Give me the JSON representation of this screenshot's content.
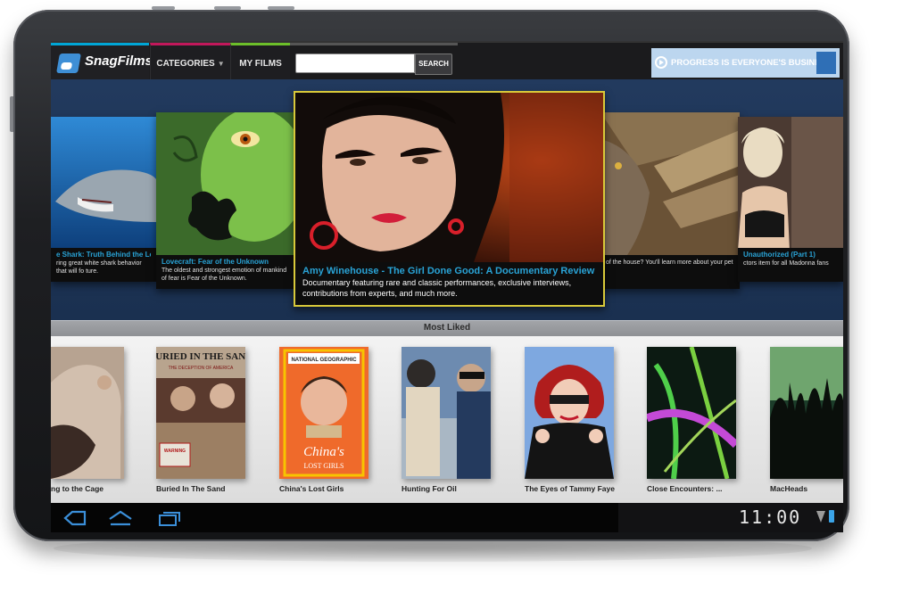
{
  "brand": {
    "name": "SnagFilms",
    "accent": "#00a6d6"
  },
  "nav": {
    "categories_label": "CATEGORIES",
    "my_films_label": "MY FILMS",
    "categories_accent": "#c2185b",
    "my_films_accent": "#6cbf2a"
  },
  "search": {
    "value": "",
    "placeholder": "",
    "button_label": "SEARCH"
  },
  "ad": {
    "text": "PROGRESS IS EVERYONE'S BUSINESS",
    "background": "#bcd6ef"
  },
  "carousel": {
    "featured": {
      "title": "Amy Winehouse - The Girl Done Good: A Documentary Review",
      "description": "Documentary featuring rare and classic performances, exclusive interviews, contributions from experts, and much more."
    },
    "left_far": {
      "title": "e Shark: Truth Behind the Legend",
      "description": "ring great white shark behavior that will fo ture."
    },
    "left_near": {
      "title": "Lovecraft: Fear of the Unknown",
      "description": "The oldest and strongest emotion of mankind of fear is Fear of the Unknown."
    },
    "right_near": {
      "title": "",
      "description": "of the house? You'll learn more about your pet"
    },
    "right_far": {
      "title": "Unauthorized (Part 1)",
      "description": "ctors item for all Madonna fans"
    }
  },
  "shelf": {
    "title": "Most Liked",
    "items": [
      {
        "label": "ng to the Cage"
      },
      {
        "label": "Buried In The Sand",
        "poster_title": "BURIED IN THE SAND",
        "poster_subtitle": "THE DECEPTION OF AMERICA",
        "poster_badge": "WARNING"
      },
      {
        "label": "China's Lost Girls",
        "poster_brand": "NATIONAL GEOGRAPHIC",
        "poster_title": "China's",
        "poster_subtitle": "LOST GIRLS"
      },
      {
        "label": "Hunting For Oil"
      },
      {
        "label": "The Eyes of Tammy Faye"
      },
      {
        "label": "Close Encounters: ..."
      },
      {
        "label": "MacHeads"
      }
    ]
  },
  "system": {
    "time": "11:00",
    "battery_color": "#3ba4e8"
  }
}
